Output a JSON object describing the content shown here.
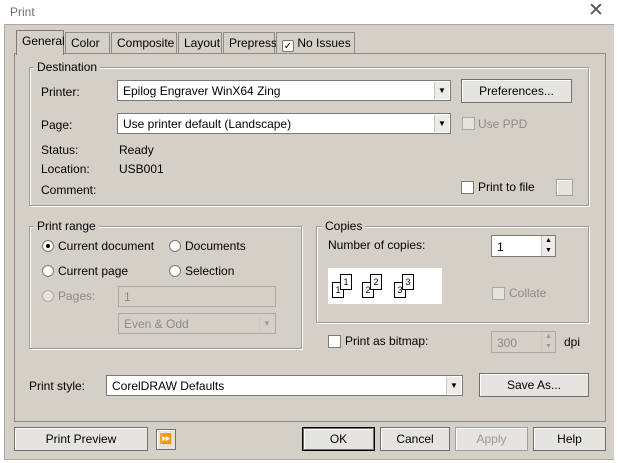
{
  "window": {
    "title": "Print"
  },
  "tabs": [
    {
      "label": "General",
      "active": true
    },
    {
      "label": "Color"
    },
    {
      "label": "Composite"
    },
    {
      "label": "Layout"
    },
    {
      "label": "Prepress"
    },
    {
      "label": "No Issues",
      "icon": "check-icon"
    }
  ],
  "destination": {
    "group_title": "Destination",
    "printer_label": "Printer:",
    "printer_value": "Epilog Engraver WinX64 Zing",
    "preferences_button": "Preferences...",
    "page_label": "Page:",
    "page_value": "Use printer default (Landscape)",
    "use_ppd_label": "Use PPD",
    "status_label": "Status:",
    "status_value": "Ready",
    "location_label": "Location:",
    "location_value": "USB001",
    "comment_label": "Comment:",
    "print_to_file_label": "Print to file"
  },
  "print_range": {
    "group_title": "Print range",
    "current_document": "Current document",
    "documents": "Documents",
    "current_page": "Current page",
    "selection": "Selection",
    "pages_label": "Pages:",
    "pages_value": "1",
    "even_odd_value": "Even & Odd",
    "selected": "current_document"
  },
  "copies": {
    "group_title": "Copies",
    "number_label": "Number of copies:",
    "number_value": "1",
    "collate_pages": [
      "1",
      "1",
      "2",
      "2",
      "3",
      "3"
    ],
    "collate_label": "Collate"
  },
  "bitmap": {
    "label": "Print as bitmap:",
    "dpi_value": "300",
    "dpi_unit": "dpi"
  },
  "print_style": {
    "label": "Print style:",
    "value": "CorelDRAW Defaults",
    "save_as_button": "Save As..."
  },
  "footer": {
    "print_preview": "Print Preview",
    "ok": "OK",
    "cancel": "Cancel",
    "apply": "Apply",
    "help": "Help"
  },
  "colors": {
    "dialog_bg": "#d4d0c8",
    "disabled_text": "#8a8a8a"
  }
}
